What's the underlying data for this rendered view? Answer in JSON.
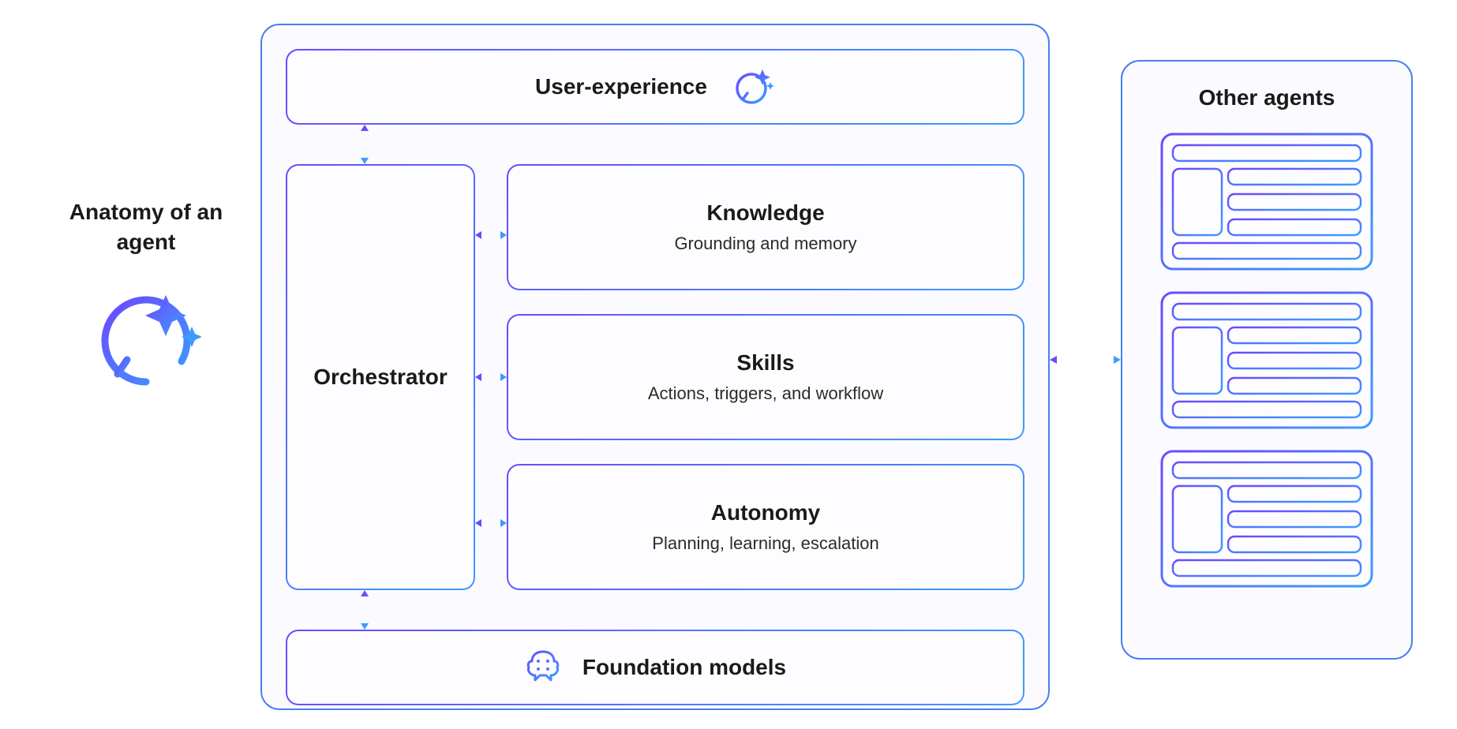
{
  "title": "Anatomy of an agent",
  "agent": {
    "user_experience": "User-experience",
    "orchestrator": "Orchestrator",
    "knowledge": {
      "title": "Knowledge",
      "subtitle": "Grounding and memory"
    },
    "skills": {
      "title": "Skills",
      "subtitle": "Actions, triggers, and workflow"
    },
    "autonomy": {
      "title": "Autonomy",
      "subtitle": "Planning, learning, escalation"
    },
    "foundation": "Foundation models"
  },
  "other_agents": {
    "title": "Other agents"
  },
  "colors": {
    "blue": "#3d9bff",
    "purple": "#6b4aff",
    "border": "#4a7ef0"
  }
}
